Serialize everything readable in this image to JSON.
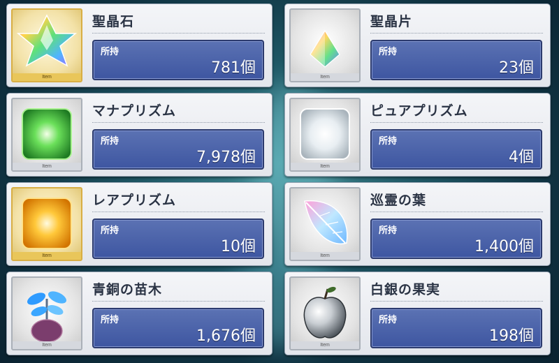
{
  "held_label": "所持",
  "item_tag": "Item",
  "items": [
    {
      "name": "聖晶石",
      "count": "781個",
      "icon": "saint-quartz-icon"
    },
    {
      "name": "聖晶片",
      "count": "23個",
      "icon": "saint-quartz-fragment-icon"
    },
    {
      "name": "マナプリズム",
      "count": "7,978個",
      "icon": "mana-prism-icon"
    },
    {
      "name": "ピュアプリズム",
      "count": "4個",
      "icon": "pure-prism-icon"
    },
    {
      "name": "レアプリズム",
      "count": "10個",
      "icon": "rare-prism-icon"
    },
    {
      "name": "巡霊の葉",
      "count": "1,400個",
      "icon": "spirit-leaf-icon"
    },
    {
      "name": "青銅の苗木",
      "count": "1,676個",
      "icon": "bronze-sapling-icon"
    },
    {
      "name": "白銀の果実",
      "count": "198個",
      "icon": "silver-fruit-icon"
    }
  ]
}
